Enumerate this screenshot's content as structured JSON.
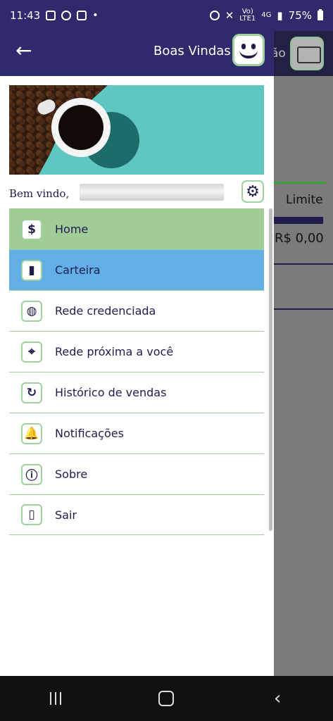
{
  "status_bar": {
    "time": "11:43",
    "network_text_top": "Vo)",
    "network_text_bottom": "LTE1",
    "signal_label": "4G",
    "battery": "75%"
  },
  "background_screen": {
    "partial_header_text": "ão",
    "limite_label": "Limite",
    "limite_value": "R$ 0,00"
  },
  "drawer": {
    "header_title": "Boas Vindas",
    "welcome_text": "Bem vindo,",
    "menu_items": [
      {
        "label": "Home",
        "icon": "dollar-icon",
        "glyph": "$",
        "highlight": "green"
      },
      {
        "label": "Carteira",
        "icon": "wallet-icon",
        "glyph": "▮",
        "highlight": "blue"
      },
      {
        "label": "Rede credenciada",
        "icon": "globe-icon",
        "glyph": "◍",
        "highlight": ""
      },
      {
        "label": "Rede próxima a você",
        "icon": "map-pin-icon",
        "glyph": "⌖",
        "highlight": ""
      },
      {
        "label": "Histórico de vendas",
        "icon": "history-24-icon",
        "glyph": "↻",
        "highlight": ""
      },
      {
        "label": "Notificações",
        "icon": "bell-icon",
        "glyph": "🔔",
        "highlight": ""
      },
      {
        "label": "Sobre",
        "icon": "info-icon",
        "glyph": "ⓘ",
        "highlight": ""
      },
      {
        "label": "Sair",
        "icon": "exit-door-icon",
        "glyph": "▯",
        "highlight": ""
      }
    ]
  },
  "colors": {
    "header": "#2e2a6b",
    "home_highlight": "#a0cc98",
    "carteira_highlight": "#62aee6",
    "accent_green": "#9ed19e",
    "text_dark": "#1f1c4d"
  }
}
